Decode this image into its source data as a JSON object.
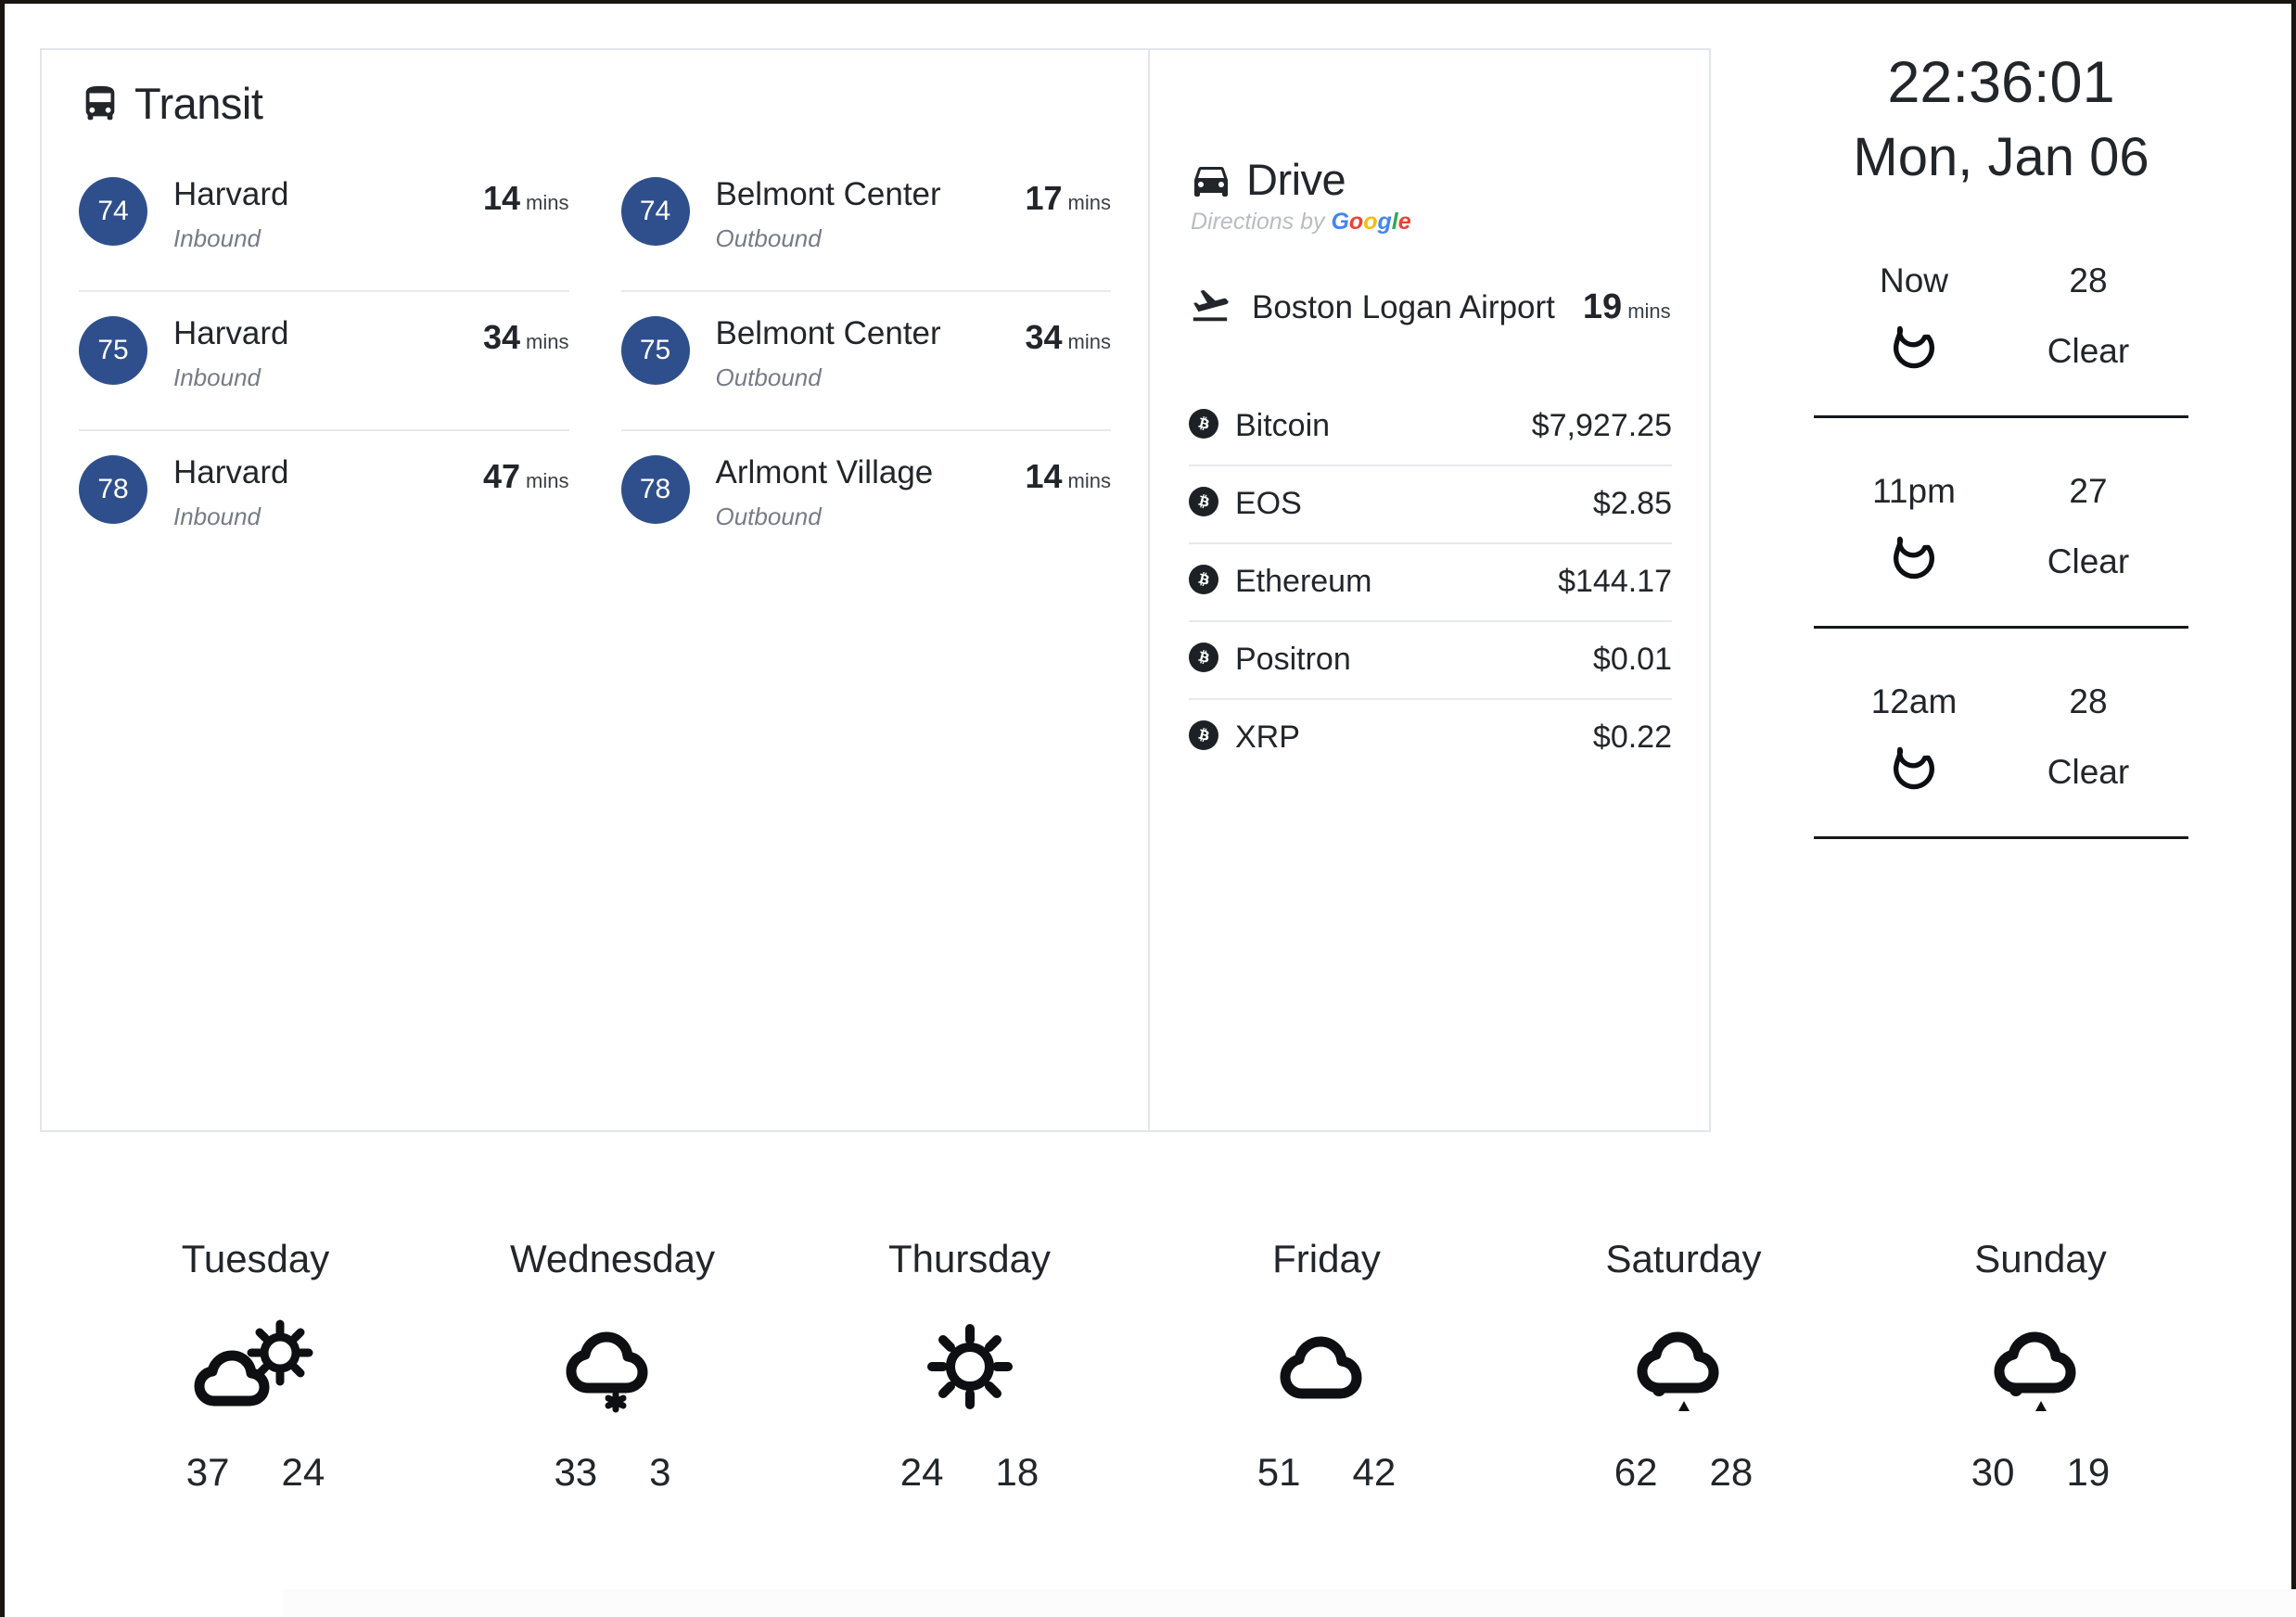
{
  "transit": {
    "title": "Transit",
    "icon": "bus-icon",
    "inbound": [
      {
        "route": "74",
        "destination": "Harvard",
        "direction": "Inbound",
        "eta": "14",
        "unit": "mins"
      },
      {
        "route": "75",
        "destination": "Harvard",
        "direction": "Inbound",
        "eta": "34",
        "unit": "mins"
      },
      {
        "route": "78",
        "destination": "Harvard",
        "direction": "Inbound",
        "eta": "47",
        "unit": "mins"
      }
    ],
    "outbound": [
      {
        "route": "74",
        "destination": "Belmont Center",
        "direction": "Outbound",
        "eta": "17",
        "unit": "mins"
      },
      {
        "route": "75",
        "destination": "Belmont Center",
        "direction": "Outbound",
        "eta": "34",
        "unit": "mins"
      },
      {
        "route": "78",
        "destination": "Arlmont Village",
        "direction": "Outbound",
        "eta": "14",
        "unit": "mins"
      }
    ],
    "badge_color": "#2f4f8c"
  },
  "drive": {
    "title": "Drive",
    "icon": "car-icon",
    "attribution_prefix": "Directions by ",
    "attribution_brand": "Google",
    "destination": {
      "icon": "airplane-icon",
      "name": "Boston Logan Airport",
      "eta": "19",
      "unit": "mins"
    }
  },
  "crypto": {
    "rows": [
      {
        "icon": "bitcoin-icon",
        "name": "Bitcoin",
        "price": "$7,927.25"
      },
      {
        "icon": "bitcoin-icon",
        "name": "EOS",
        "price": "$2.85"
      },
      {
        "icon": "bitcoin-icon",
        "name": "Ethereum",
        "price": "$144.17"
      },
      {
        "icon": "bitcoin-icon",
        "name": "Positron",
        "price": "$0.01"
      },
      {
        "icon": "bitcoin-icon",
        "name": "XRP",
        "price": "$0.22"
      }
    ]
  },
  "clock": {
    "time": "22:36:01",
    "date": "Mon, Jan 06"
  },
  "hourly": [
    {
      "time": "Now",
      "temp": "28",
      "condition": "Clear",
      "icon": "moon-icon"
    },
    {
      "time": "11pm",
      "temp": "27",
      "condition": "Clear",
      "icon": "moon-icon"
    },
    {
      "time": "12am",
      "temp": "28",
      "condition": "Clear",
      "icon": "moon-icon"
    }
  ],
  "daily": [
    {
      "day": "Tuesday",
      "icon": "cloud-sun-icon",
      "high": "37",
      "low": "24"
    },
    {
      "day": "Wednesday",
      "icon": "cloud-snow-icon",
      "high": "33",
      "low": "3"
    },
    {
      "day": "Thursday",
      "icon": "sun-icon",
      "high": "24",
      "low": "18"
    },
    {
      "day": "Friday",
      "icon": "cloud-icon",
      "high": "51",
      "low": "42"
    },
    {
      "day": "Saturday",
      "icon": "cloud-rain-icon",
      "high": "62",
      "low": "28"
    },
    {
      "day": "Sunday",
      "icon": "cloud-rain-icon",
      "high": "30",
      "low": "19"
    }
  ],
  "colors": {
    "badge_blue": "#2f4f8c",
    "text_dark": "#22262b",
    "muted": "#767c86",
    "rule": "#e7e9ec",
    "google_blue": "#4285F4",
    "google_red": "#EA4335",
    "google_yellow": "#FBBC05",
    "google_green": "#34A853"
  }
}
